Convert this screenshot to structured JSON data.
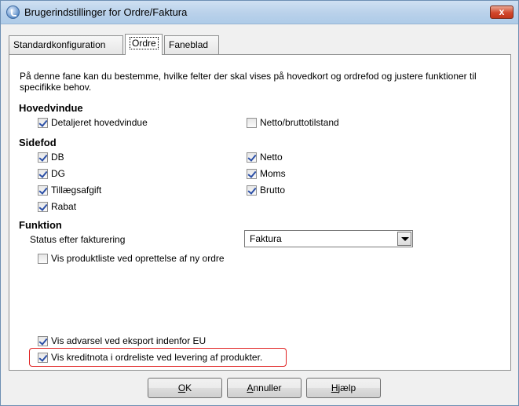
{
  "window": {
    "title": "Brugerindstillinger for Ordre/Faktura",
    "close_label": "x"
  },
  "tabs": [
    {
      "label": "Standardkonfiguration",
      "active": false
    },
    {
      "label": "Ordre",
      "active": true
    },
    {
      "label": "Faneblad",
      "active": false
    }
  ],
  "description": "På denne fane kan du bestemme, hvilke felter der skal vises på hovedkort og ordrefod og justere funktioner til specifikke behov.",
  "hovedvindue": {
    "title": "Hovedvindue",
    "detaljeret": {
      "label": "Detaljeret hovedvindue",
      "checked": true
    },
    "netto_brutto": {
      "label": "Netto/bruttotilstand",
      "checked": false
    }
  },
  "sidefod": {
    "title": "Sidefod",
    "db": {
      "label": "DB",
      "checked": true
    },
    "dg": {
      "label": "DG",
      "checked": true
    },
    "tillaeg": {
      "label": "Tillægsafgift",
      "checked": true
    },
    "rabat": {
      "label": "Rabat",
      "checked": true
    },
    "netto": {
      "label": "Netto",
      "checked": true
    },
    "moms": {
      "label": "Moms",
      "checked": true
    },
    "brutto": {
      "label": "Brutto",
      "checked": true
    }
  },
  "funktion": {
    "title": "Funktion",
    "status_label": "Status efter fakturering",
    "status_value": "Faktura",
    "produktliste": {
      "label": "Vis produktliste ved oprettelse af ny ordre",
      "checked": false
    }
  },
  "advarsel": {
    "label": "Vis advarsel ved eksport indenfor EU",
    "checked": true
  },
  "kreditnota": {
    "label": "Vis kreditnota i ordreliste ved levering af produkter.",
    "checked": true
  },
  "buttons": {
    "ok": {
      "mnemonic": "O",
      "rest": "K"
    },
    "annuller": {
      "mnemonic": "A",
      "rest": "nnuller"
    },
    "hjaelp": {
      "mnemonic": "H",
      "rest": "jælp"
    }
  }
}
